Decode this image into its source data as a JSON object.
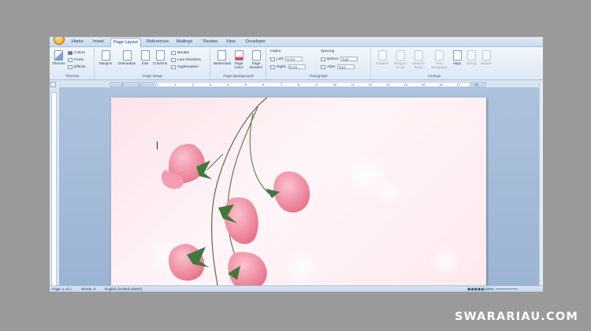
{
  "tabs": [
    {
      "label": "Home",
      "active": false
    },
    {
      "label": "Insert",
      "active": false
    },
    {
      "label": "Page Layout",
      "active": true
    },
    {
      "label": "References",
      "active": false
    },
    {
      "label": "Mailings",
      "active": false
    },
    {
      "label": "Review",
      "active": false
    },
    {
      "label": "View",
      "active": false
    },
    {
      "label": "Developer",
      "active": false
    }
  ],
  "themes": {
    "big": "Themes",
    "colors": "Colors",
    "fonts": "Fonts",
    "effects": "Effects",
    "group": "Themes"
  },
  "page_setup": {
    "margins": "Margins",
    "orientation": "Orientation",
    "size": "Size",
    "columns": "Columns",
    "breaks": "Breaks",
    "line_numbers": "Line Numbers",
    "hyphenation": "Hyphenation",
    "group": "Page Setup"
  },
  "page_background": {
    "watermark": "Watermark",
    "page_color_1": "Page",
    "page_color_2": "Color",
    "page_borders_1": "Page",
    "page_borders_2": "Borders",
    "group": "Page Background"
  },
  "paragraph": {
    "indent_title": "Indent",
    "left_label": "Left:",
    "left_value": "0 cm",
    "right_label": "Right:",
    "right_value": "0 cm",
    "spacing_title": "Spacing",
    "before_label": "Before:",
    "before_value": "0 pt",
    "after_label": "After:",
    "after_value": "8 pt",
    "group": "Paragraph"
  },
  "arrange": {
    "position": "Position",
    "bring_front_1": "Bring to",
    "bring_front_2": "Front",
    "send_back_1": "Send to",
    "send_back_2": "Back",
    "text_wrap_1": "Text",
    "text_wrap_2": "Wrapping",
    "align": "Align",
    "group_btn": "Group",
    "rotate": "Rotate",
    "group": "Arrange"
  },
  "ruler_numbers": [
    "3",
    "2",
    "1",
    "1",
    "2",
    "3",
    "4",
    "5",
    "6",
    "7",
    "8",
    "9",
    "10",
    "11",
    "12",
    "13",
    "14",
    "15",
    "16",
    "17",
    "18"
  ],
  "status": {
    "page": "Page: 1 of 1",
    "words": "Words: 0",
    "language": "English (United States)",
    "zoom": "100%"
  },
  "watermark_text": "SWARARIAU.COM",
  "colors": {
    "accent": "#dbe5f2",
    "page": "#fbe3ea",
    "flower": "#f08fa3",
    "leaf": "#3f7a3a"
  }
}
